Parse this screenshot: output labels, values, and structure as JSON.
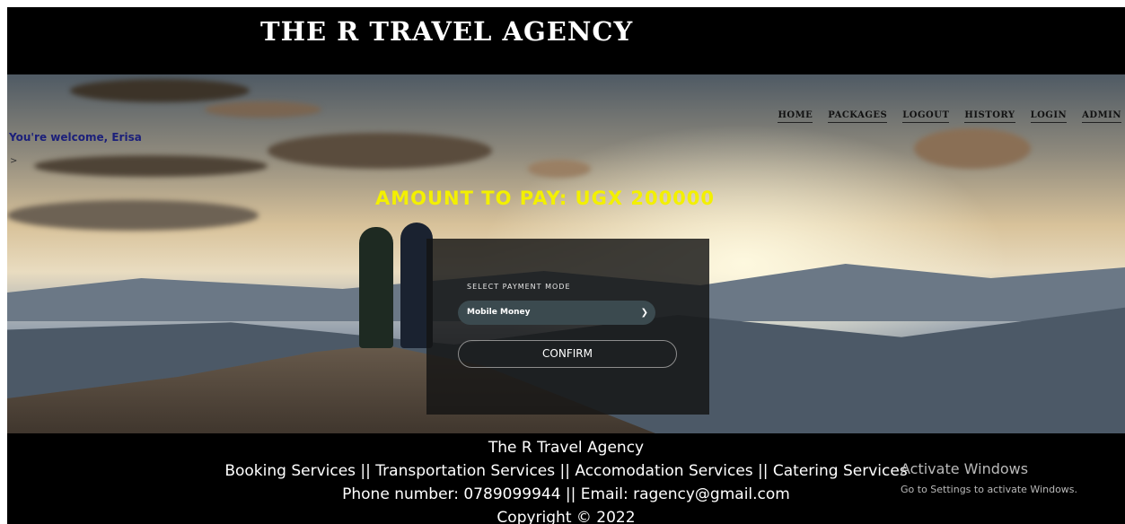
{
  "header": {
    "title": "THE R TRAVEL AGENCY"
  },
  "nav": {
    "items": [
      {
        "label": "HOME"
      },
      {
        "label": "PACKAGES"
      },
      {
        "label": "LOGOUT"
      },
      {
        "label": "HISTORY"
      },
      {
        "label": "LOGIN"
      },
      {
        "label": "ADMIN"
      }
    ]
  },
  "welcome": {
    "text": "You're welcome, Erisa",
    "marker": ">"
  },
  "payment": {
    "amount_text": "AMOUNT TO PAY: UGX 200000",
    "mode_label": "SELECT PAYMENT MODE",
    "mode_selected": "Mobile Money",
    "confirm_label": "CONFIRM"
  },
  "footer": {
    "name": "The R Travel Agency",
    "services": "Booking Services || Transportation Services || Accomodation Services || Catering Services",
    "contact": "Phone number: 0789099944 || Email: ragency@gmail.com",
    "copyright": "Copyright © 2022"
  },
  "os_watermark": {
    "line1": "Activate Windows",
    "line2": "Go to Settings to activate Windows."
  },
  "colors": {
    "header_bg": "#000000",
    "amount": "#f3f000",
    "welcome": "#1b1f7a",
    "panel": "#141414"
  }
}
